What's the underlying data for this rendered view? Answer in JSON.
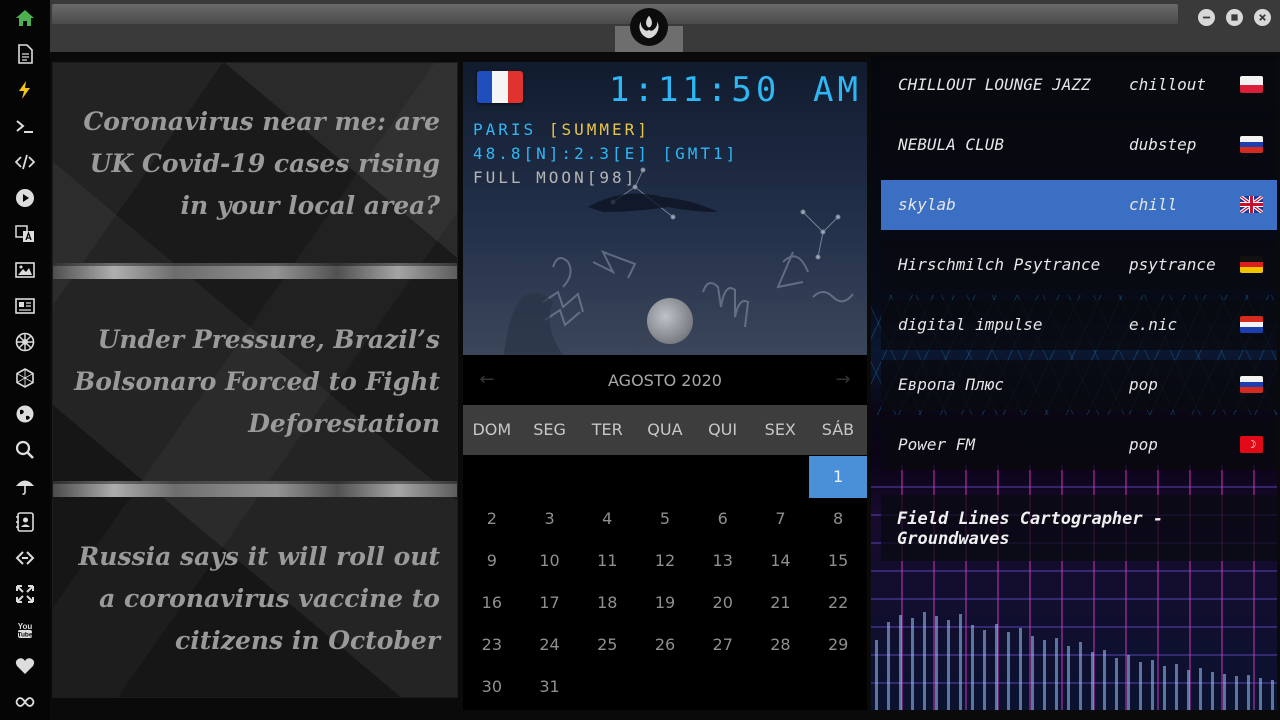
{
  "sidebar": {
    "items": [
      {
        "icon": "home-icon"
      },
      {
        "icon": "document-icon"
      },
      {
        "icon": "lightning-icon"
      },
      {
        "icon": "terminal-icon"
      },
      {
        "icon": "code-icon"
      },
      {
        "icon": "play-icon"
      },
      {
        "icon": "translate-icon"
      },
      {
        "icon": "image-icon"
      },
      {
        "icon": "news-icon"
      },
      {
        "icon": "galactic-empire-icon"
      },
      {
        "icon": "hexagon-icon"
      },
      {
        "icon": "globe-icon"
      },
      {
        "icon": "search-icon"
      },
      {
        "icon": "umbrella-icon"
      },
      {
        "icon": "contacts-icon"
      },
      {
        "icon": "link-icon"
      },
      {
        "icon": "expand-icon"
      },
      {
        "icon": "youtube-icon"
      },
      {
        "icon": "heart-icon"
      },
      {
        "icon": "infinity-icon"
      }
    ],
    "accent": "#4caf50"
  },
  "window": {
    "logo_icon": "rebel-alliance-icon"
  },
  "news": {
    "items": [
      {
        "title": "Coronavirus near me: are UK Covid-19 cases rising in your local area?"
      },
      {
        "title": "Under Pressure, Brazil’s Bolsonaro Forced to Fight Deforestation"
      },
      {
        "title": "Russia says it will roll out a coronavirus vaccine to citizens in October"
      }
    ]
  },
  "clock": {
    "time": "1:11:50",
    "ampm": "AM",
    "city": "PARIS",
    "season": "[SUMMER]",
    "coords": "48.8[N]:2.3[E] [GMT1]",
    "moon": "FULL MOON[98]",
    "colors": {
      "time": "#2fb7f5",
      "city": "#2fb7f5",
      "season": "#e8c547",
      "moon": "#b5b5b5"
    }
  },
  "calendar": {
    "month_label": "AGOSTO 2020",
    "weekdays": [
      "DOM",
      "SEG",
      "TER",
      "QUA",
      "QUI",
      "SEX",
      "SÁB"
    ],
    "days": [
      "1",
      "2",
      "3",
      "4",
      "5",
      "6",
      "7",
      "8",
      "9",
      "10",
      "11",
      "12",
      "13",
      "14",
      "15",
      "16",
      "17",
      "18",
      "19",
      "20",
      "21",
      "22",
      "23",
      "24",
      "25",
      "26",
      "27",
      "28",
      "29",
      "30",
      "31"
    ],
    "first_weekday": 6,
    "selected_day": "1",
    "selected_color": "#4a90d9"
  },
  "radio": {
    "stations": [
      {
        "name": "CHILLOUT LOUNGE JAZZ",
        "genre": "chillout",
        "flag": "poland-flag-icon"
      },
      {
        "name": "NEBULA CLUB",
        "genre": "dubstep",
        "flag": "russia-flag-icon"
      },
      {
        "name": "skylab",
        "genre": "chill",
        "flag": "uk-flag-icon",
        "active": true
      },
      {
        "name": "Hirschmilch Psytrance",
        "genre": "psytrance",
        "flag": "germany-flag-icon"
      },
      {
        "name": "digital impulse",
        "genre": "e.nic",
        "flag": "croatia-flag-icon"
      },
      {
        "name": "Европа Плюс",
        "genre": "pop",
        "flag": "russia-flag-icon"
      },
      {
        "name": "Power FM",
        "genre": "pop",
        "flag": "turkey-flag-icon"
      }
    ],
    "now_playing": "Field Lines Cartographer - Groundwaves",
    "active_color": "#3a6fc4"
  }
}
